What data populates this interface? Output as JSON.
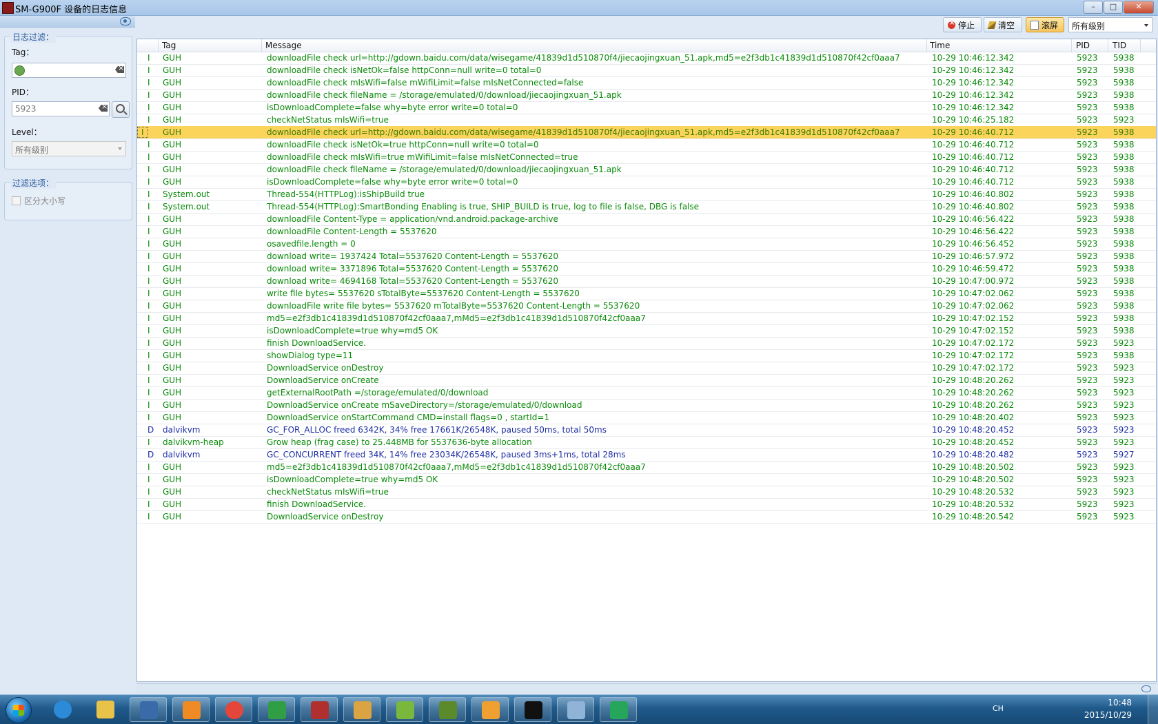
{
  "window": {
    "title": "SM-G900F 设备的日志信息"
  },
  "left": {
    "filter_legend": "日志过滤：",
    "tag_label": "Tag：",
    "tag_value": "",
    "pid_label": "PID：",
    "pid_value": "5923",
    "level_label": "Level：",
    "level_value": "所有级别",
    "options_legend": "过滤选项：",
    "case_label": "区分大小写"
  },
  "toolbar": {
    "stop_label": "停止",
    "clear_label": "清空",
    "scroll_label": "滚屏",
    "level_select": "所有级别"
  },
  "table": {
    "headers": {
      "tag": "Tag",
      "message": "Message",
      "time": "Time",
      "pid": "PID",
      "tid": "TID"
    },
    "selected_index": 6,
    "rows": [
      {
        "level": "I",
        "tag": "GUH",
        "message": "downloadFile check url=http://gdown.baidu.com/data/wisegame/41839d1d510870f4/jiecaojingxuan_51.apk,md5=e2f3db1c41839d1d510870f42cf0aaa7",
        "time": "10-29 10:46:12.342",
        "pid": "5923",
        "tid": "5938"
      },
      {
        "level": "I",
        "tag": "GUH",
        "message": "downloadFile check isNetOk=false httpConn=null write=0 total=0",
        "time": "10-29 10:46:12.342",
        "pid": "5923",
        "tid": "5938"
      },
      {
        "level": "I",
        "tag": "GUH",
        "message": "downloadFile check mIsWifi=false mWifiLimit=false mIsNetConnected=false",
        "time": "10-29 10:46:12.342",
        "pid": "5923",
        "tid": "5938"
      },
      {
        "level": "I",
        "tag": "GUH",
        "message": "downloadFile check fileName = /storage/emulated/0/download/jiecaojingxuan_51.apk",
        "time": "10-29 10:46:12.342",
        "pid": "5923",
        "tid": "5938"
      },
      {
        "level": "I",
        "tag": "GUH",
        "message": "isDownloadComplete=false why=byte error write=0 total=0",
        "time": "10-29 10:46:12.342",
        "pid": "5923",
        "tid": "5938"
      },
      {
        "level": "I",
        "tag": "GUH",
        "message": "checkNetStatus mIsWifi=true",
        "time": "10-29 10:46:25.182",
        "pid": "5923",
        "tid": "5923"
      },
      {
        "level": "I",
        "tag": "GUH",
        "message": "downloadFile check url=http://gdown.baidu.com/data/wisegame/41839d1d510870f4/jiecaojingxuan_51.apk,md5=e2f3db1c41839d1d510870f42cf0aaa7",
        "time": "10-29 10:46:40.712",
        "pid": "5923",
        "tid": "5938"
      },
      {
        "level": "I",
        "tag": "GUH",
        "message": "downloadFile check isNetOk=true httpConn=null write=0 total=0",
        "time": "10-29 10:46:40.712",
        "pid": "5923",
        "tid": "5938"
      },
      {
        "level": "I",
        "tag": "GUH",
        "message": "downloadFile check mIsWifi=true mWifiLimit=false mIsNetConnected=true",
        "time": "10-29 10:46:40.712",
        "pid": "5923",
        "tid": "5938"
      },
      {
        "level": "I",
        "tag": "GUH",
        "message": "downloadFile check fileName = /storage/emulated/0/download/jiecaojingxuan_51.apk",
        "time": "10-29 10:46:40.712",
        "pid": "5923",
        "tid": "5938"
      },
      {
        "level": "I",
        "tag": "GUH",
        "message": "isDownloadComplete=false why=byte error write=0 total=0",
        "time": "10-29 10:46:40.712",
        "pid": "5923",
        "tid": "5938"
      },
      {
        "level": "I",
        "tag": "System.out",
        "message": "Thread-554(HTTPLog):isShipBuild true",
        "time": "10-29 10:46:40.802",
        "pid": "5923",
        "tid": "5938"
      },
      {
        "level": "I",
        "tag": "System.out",
        "message": "Thread-554(HTTPLog):SmartBonding Enabling is true, SHIP_BUILD is true, log to file is false, DBG is false",
        "time": "10-29 10:46:40.802",
        "pid": "5923",
        "tid": "5938"
      },
      {
        "level": "I",
        "tag": "GUH",
        "message": "downloadFile Content-Type = application/vnd.android.package-archive",
        "time": "10-29 10:46:56.422",
        "pid": "5923",
        "tid": "5938"
      },
      {
        "level": "I",
        "tag": "GUH",
        "message": "downloadFile Content-Length = 5537620",
        "time": "10-29 10:46:56.422",
        "pid": "5923",
        "tid": "5938"
      },
      {
        "level": "I",
        "tag": "GUH",
        "message": "osavedfile.length = 0",
        "time": "10-29 10:46:56.452",
        "pid": "5923",
        "tid": "5938"
      },
      {
        "level": "I",
        "tag": "GUH",
        "message": "download write= 1937424 Total=5537620 Content-Length = 5537620",
        "time": "10-29 10:46:57.972",
        "pid": "5923",
        "tid": "5938"
      },
      {
        "level": "I",
        "tag": "GUH",
        "message": "download write= 3371896 Total=5537620 Content-Length = 5537620",
        "time": "10-29 10:46:59.472",
        "pid": "5923",
        "tid": "5938"
      },
      {
        "level": "I",
        "tag": "GUH",
        "message": "download write= 4694168 Total=5537620 Content-Length = 5537620",
        "time": "10-29 10:47:00.972",
        "pid": "5923",
        "tid": "5938"
      },
      {
        "level": "I",
        "tag": "GUH",
        "message": "write file bytes= 5537620 sTotalByte=5537620 Content-Length = 5537620",
        "time": "10-29 10:47:02.062",
        "pid": "5923",
        "tid": "5938"
      },
      {
        "level": "I",
        "tag": "GUH",
        "message": "downloadFile write file bytes= 5537620 mTotalByte=5537620 Content-Length = 5537620",
        "time": "10-29 10:47:02.062",
        "pid": "5923",
        "tid": "5938"
      },
      {
        "level": "I",
        "tag": "GUH",
        "message": "md5=e2f3db1c41839d1d510870f42cf0aaa7,mMd5=e2f3db1c41839d1d510870f42cf0aaa7",
        "time": "10-29 10:47:02.152",
        "pid": "5923",
        "tid": "5938"
      },
      {
        "level": "I",
        "tag": "GUH",
        "message": "isDownloadComplete=true why=md5 OK",
        "time": "10-29 10:47:02.152",
        "pid": "5923",
        "tid": "5938"
      },
      {
        "level": "I",
        "tag": "GUH",
        "message": "finish DownloadService.",
        "time": "10-29 10:47:02.172",
        "pid": "5923",
        "tid": "5923"
      },
      {
        "level": "I",
        "tag": "GUH",
        "message": "showDialog type=11",
        "time": "10-29 10:47:02.172",
        "pid": "5923",
        "tid": "5938"
      },
      {
        "level": "I",
        "tag": "GUH",
        "message": "DownloadService onDestroy",
        "time": "10-29 10:47:02.172",
        "pid": "5923",
        "tid": "5923"
      },
      {
        "level": "I",
        "tag": "GUH",
        "message": "DownloadService onCreate",
        "time": "10-29 10:48:20.262",
        "pid": "5923",
        "tid": "5923"
      },
      {
        "level": "I",
        "tag": "GUH",
        "message": "getExternalRootPath =/storage/emulated/0/download",
        "time": "10-29 10:48:20.262",
        "pid": "5923",
        "tid": "5923"
      },
      {
        "level": "I",
        "tag": "GUH",
        "message": "DownloadService onCreate mSaveDirectory=/storage/emulated/0/download",
        "time": "10-29 10:48:20.262",
        "pid": "5923",
        "tid": "5923"
      },
      {
        "level": "I",
        "tag": "GUH",
        "message": "DownloadService onStartCommand CMD=install flags=0 , startId=1",
        "time": "10-29 10:48:20.402",
        "pid": "5923",
        "tid": "5923"
      },
      {
        "level": "D",
        "tag": "dalvikvm",
        "message": "GC_FOR_ALLOC freed 6342K, 34% free 17661K/26548K, paused 50ms, total 50ms",
        "time": "10-29 10:48:20.452",
        "pid": "5923",
        "tid": "5923"
      },
      {
        "level": "I",
        "tag": "dalvikvm-heap",
        "message": "Grow heap (frag case) to 25.448MB for 5537636-byte allocation",
        "time": "10-29 10:48:20.452",
        "pid": "5923",
        "tid": "5923"
      },
      {
        "level": "D",
        "tag": "dalvikvm",
        "message": "GC_CONCURRENT freed 34K, 14% free 23034K/26548K, paused 3ms+1ms, total 28ms",
        "time": "10-29 10:48:20.482",
        "pid": "5923",
        "tid": "5927"
      },
      {
        "level": "I",
        "tag": "GUH",
        "message": "md5=e2f3db1c41839d1d510870f42cf0aaa7,mMd5=e2f3db1c41839d1d510870f42cf0aaa7",
        "time": "10-29 10:48:20.502",
        "pid": "5923",
        "tid": "5923"
      },
      {
        "level": "I",
        "tag": "GUH",
        "message": "isDownloadComplete=true why=md5 OK",
        "time": "10-29 10:48:20.502",
        "pid": "5923",
        "tid": "5923"
      },
      {
        "level": "I",
        "tag": "GUH",
        "message": "checkNetStatus mIsWifi=true",
        "time": "10-29 10:48:20.532",
        "pid": "5923",
        "tid": "5923"
      },
      {
        "level": "I",
        "tag": "GUH",
        "message": "finish DownloadService.",
        "time": "10-29 10:48:20.532",
        "pid": "5923",
        "tid": "5923"
      },
      {
        "level": "I",
        "tag": "GUH",
        "message": "DownloadService onDestroy",
        "time": "10-29 10:48:20.542",
        "pid": "5923",
        "tid": "5923"
      }
    ]
  },
  "taskbar": {
    "items": [
      "ie-icon",
      "explorer-icon",
      "monitor-icon",
      "sublime-icon",
      "chrome-icon",
      "brackets-icon",
      "app-icon",
      "java-icon",
      "tool-icon",
      "notepad-icon",
      "colorful-icon",
      "cmd-icon",
      "paint-icon",
      "game-icon"
    ],
    "lang": "CH",
    "time": "10:48",
    "date": "2015/10/29"
  },
  "colors": {
    "info": "#0a8a0a",
    "debug": "#1f2fa5",
    "selected_row": "#fbd45c"
  }
}
